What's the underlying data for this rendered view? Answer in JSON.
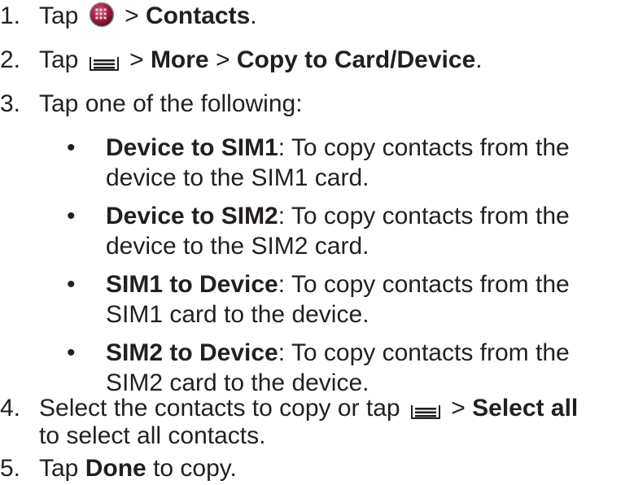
{
  "steps": [
    {
      "num": "1.",
      "pre": "Tap",
      "icon": "apps-icon",
      "sep": ">",
      "bold": "Contacts",
      "post": "."
    },
    {
      "num": "2.",
      "pre": "Tap",
      "icon": "menu-icon",
      "sep1": ">",
      "bold1": "More",
      "sep2": ">",
      "bold2": "Copy to Card/Device",
      "post": "."
    },
    {
      "num": "3.",
      "text": "Tap one of the following:"
    },
    {
      "num": "4.",
      "pre": "Select the contacts to copy or tap",
      "icon": "menu-icon",
      "sep": ">",
      "bold": "Select all",
      "cont": "to select all contacts."
    },
    {
      "num": "5.",
      "pre": "Tap",
      "bold": "Done",
      "post": "to copy."
    }
  ],
  "options": [
    {
      "bullet": "•",
      "bold": "Device to SIM1",
      "rest": ": To copy contacts from the",
      "cont": "device to the SIM1 card."
    },
    {
      "bullet": "•",
      "bold": "Device to SIM2",
      "rest": ": To copy contacts from the",
      "cont": "device to the SIM2 card."
    },
    {
      "bullet": "•",
      "bold": "SIM1 to Device",
      "rest": ": To copy contacts from the",
      "cont": "SIM1 card to the device."
    },
    {
      "bullet": "•",
      "bold": "SIM2 to Device",
      "rest": ": To copy contacts from the",
      "cont": "SIM2 card to the device."
    }
  ],
  "colors": {
    "text": "#231f20",
    "apps_icon": "#8f1b3a"
  }
}
